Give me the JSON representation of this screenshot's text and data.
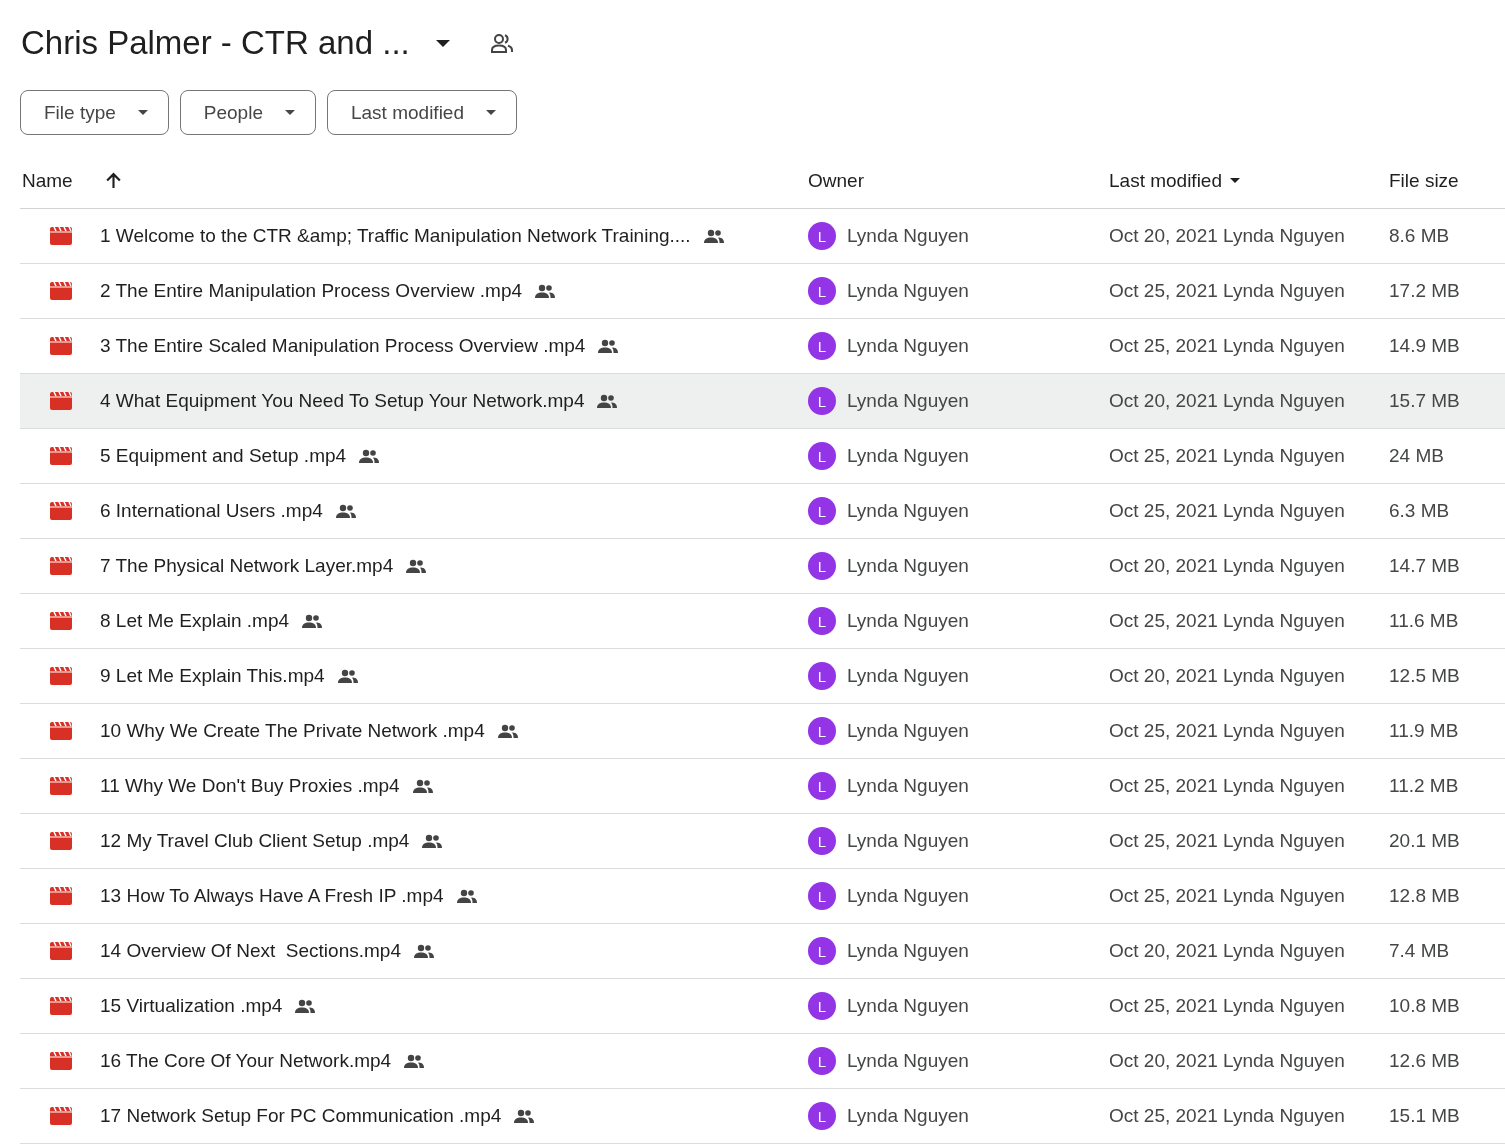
{
  "folder": {
    "title": "Chris Palmer - CTR and ..."
  },
  "filters": [
    "File type",
    "People",
    "Last modified"
  ],
  "columns": {
    "name": "Name",
    "owner": "Owner",
    "modified": "Last modified",
    "size": "File size"
  },
  "rows": [
    {
      "name": "1 Welcome to the CTR &amp; Traffic Manipulation Network Training....",
      "initial": "L",
      "owner": "Lynda Nguyen",
      "date": "Oct 20, 2021",
      "modifier": "Lynda Nguyen",
      "size": "8.6 MB",
      "highlighted": false
    },
    {
      "name": "2 The Entire Manipulation Process Overview .mp4",
      "initial": "L",
      "owner": "Lynda Nguyen",
      "date": "Oct 25, 2021",
      "modifier": "Lynda Nguyen",
      "size": "17.2 MB",
      "highlighted": false
    },
    {
      "name": "3 The Entire Scaled Manipulation Process Overview .mp4",
      "initial": "L",
      "owner": "Lynda Nguyen",
      "date": "Oct 25, 2021",
      "modifier": "Lynda Nguyen",
      "size": "14.9 MB",
      "highlighted": false
    },
    {
      "name": "4 What Equipment You Need To Setup Your Network.mp4",
      "initial": "L",
      "owner": "Lynda Nguyen",
      "date": "Oct 20, 2021",
      "modifier": "Lynda Nguyen",
      "size": "15.7 MB",
      "highlighted": true
    },
    {
      "name": "5 Equipment and Setup .mp4",
      "initial": "L",
      "owner": "Lynda Nguyen",
      "date": "Oct 25, 2021",
      "modifier": "Lynda Nguyen",
      "size": "24 MB",
      "highlighted": false
    },
    {
      "name": "6 International Users .mp4",
      "initial": "L",
      "owner": "Lynda Nguyen",
      "date": "Oct 25, 2021",
      "modifier": "Lynda Nguyen",
      "size": "6.3 MB",
      "highlighted": false
    },
    {
      "name": "7 The Physical Network Layer.mp4",
      "initial": "L",
      "owner": "Lynda Nguyen",
      "date": "Oct 20, 2021",
      "modifier": "Lynda Nguyen",
      "size": "14.7 MB",
      "highlighted": false
    },
    {
      "name": "8 Let Me Explain .mp4",
      "initial": "L",
      "owner": "Lynda Nguyen",
      "date": "Oct 25, 2021",
      "modifier": "Lynda Nguyen",
      "size": "11.6 MB",
      "highlighted": false
    },
    {
      "name": "9 Let Me Explain This.mp4",
      "initial": "L",
      "owner": "Lynda Nguyen",
      "date": "Oct 20, 2021",
      "modifier": "Lynda Nguyen",
      "size": "12.5 MB",
      "highlighted": false
    },
    {
      "name": "10 Why We Create The Private Network .mp4",
      "initial": "L",
      "owner": "Lynda Nguyen",
      "date": "Oct 25, 2021",
      "modifier": "Lynda Nguyen",
      "size": "11.9 MB",
      "highlighted": false
    },
    {
      "name": "11 Why We Don't Buy Proxies .mp4",
      "initial": "L",
      "owner": "Lynda Nguyen",
      "date": "Oct 25, 2021",
      "modifier": "Lynda Nguyen",
      "size": "11.2 MB",
      "highlighted": false
    },
    {
      "name": "12 My Travel Club Client Setup .mp4",
      "initial": "L",
      "owner": "Lynda Nguyen",
      "date": "Oct 25, 2021",
      "modifier": "Lynda Nguyen",
      "size": "20.1 MB",
      "highlighted": false
    },
    {
      "name": "13 How To Always Have A Fresh IP .mp4",
      "initial": "L",
      "owner": "Lynda Nguyen",
      "date": "Oct 25, 2021",
      "modifier": "Lynda Nguyen",
      "size": "12.8 MB",
      "highlighted": false
    },
    {
      "name": "14 Overview Of Next  Sections.mp4",
      "initial": "L",
      "owner": "Lynda Nguyen",
      "date": "Oct 20, 2021",
      "modifier": "Lynda Nguyen",
      "size": "7.4 MB",
      "highlighted": false
    },
    {
      "name": "15 Virtualization .mp4",
      "initial": "L",
      "owner": "Lynda Nguyen",
      "date": "Oct 25, 2021",
      "modifier": "Lynda Nguyen",
      "size": "10.8 MB",
      "highlighted": false
    },
    {
      "name": "16 The Core Of Your Network.mp4",
      "initial": "L",
      "owner": "Lynda Nguyen",
      "date": "Oct 20, 2021",
      "modifier": "Lynda Nguyen",
      "size": "12.6 MB",
      "highlighted": false
    },
    {
      "name": "17 Network Setup For PC Communication .mp4",
      "initial": "L",
      "owner": "Lynda Nguyen",
      "date": "Oct 25, 2021",
      "modifier": "Lynda Nguyen",
      "size": "15.1 MB",
      "highlighted": false
    }
  ]
}
